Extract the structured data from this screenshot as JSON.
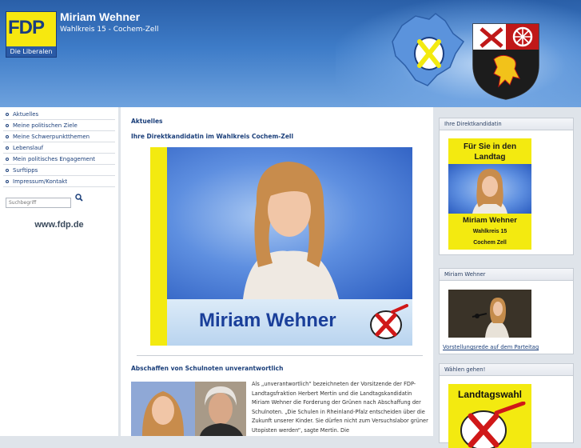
{
  "header": {
    "logo_text": "FDP",
    "logo_sub": "Die Liberalen",
    "title": "Miriam Wehner",
    "subtitle": "Wahlkreis 15 - Cochem-Zell"
  },
  "nav": {
    "items": [
      {
        "label": "Aktuelles"
      },
      {
        "label": "Meine politischen Ziele"
      },
      {
        "label": "Meine Schwerpunktthemen"
      },
      {
        "label": "Lebenslauf"
      },
      {
        "label": "Mein politisches Engagement"
      },
      {
        "label": "Surftipps"
      },
      {
        "label": "Impressum/Kontakt"
      }
    ]
  },
  "search": {
    "placeholder": "Suchbegriff",
    "icon": "search-icon"
  },
  "fdp_link": "www.fdp.de",
  "main": {
    "section_title": "Aktuelles",
    "article1_title": "Ihre Direktkandidatin im Wahlkreis Cochem-Zell",
    "banner_name": "Miriam Wehner",
    "article2_title": "Abschaffen von Schulnoten unverantwortlich",
    "article2_text": "Als „unverantwortlich“ bezeichneten der Vorsitzende der FDP-Landtagsfraktion Herbert Mertin und die Landtagskandidatin Miriam Wehner die Forderung der Grünen nach Abschaffung der Schulnoten. „Die Schulen in Rheinland-Pfalz entscheiden über die Zukunft unserer Kinder. Sie dürfen nicht zum Versuchslabor grüner Utopisten werden“, sagte Mertin. Die"
  },
  "right": {
    "box1": {
      "title": "Ihre Direktkandidatin",
      "poster_line1": "Für Sie in den",
      "poster_line2": "Landtag",
      "poster_name": "Miriam Wehner",
      "poster_wk": "Wahlkreis 15",
      "poster_city": "Cochem Zell"
    },
    "box2": {
      "title": "Miriam Wehner",
      "link": "Vorstellungsrede auf dem Parteitag"
    },
    "box3": {
      "title": "Wählen gehen!",
      "poster_text": "Landtagswahl"
    }
  },
  "colors": {
    "fdp_yellow": "#f7e80f",
    "fdp_blue": "#1a3d80",
    "header_blue": "#3e7cc8",
    "link_blue": "#1b3f7a"
  }
}
